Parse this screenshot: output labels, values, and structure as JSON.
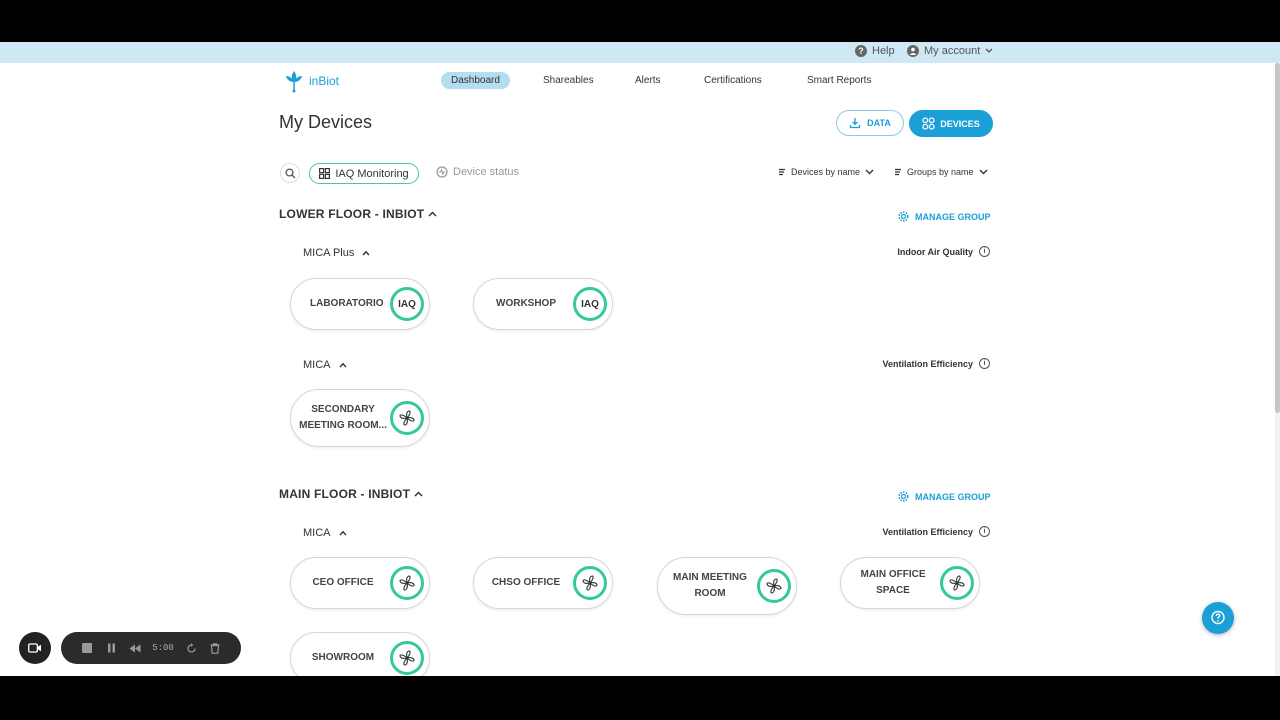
{
  "top_bar": {
    "help_label": "Help",
    "account_label": "My account"
  },
  "logo": {
    "text": "inBiot"
  },
  "nav": {
    "items": [
      {
        "label": "Dashboard",
        "active": true
      },
      {
        "label": "Shareables"
      },
      {
        "label": "Alerts"
      },
      {
        "label": "Certifications"
      },
      {
        "label": "Smart Reports"
      }
    ]
  },
  "page": {
    "title": "My Devices",
    "data_button": "DATA",
    "devices_button": "DEVICES"
  },
  "filters": {
    "monitoring_chip": "IAQ Monitoring",
    "status_chip": "Device status",
    "sort_devices": "Devices by name",
    "sort_groups": "Groups by name"
  },
  "groups": [
    {
      "title": "LOWER FLOOR - INBIOT",
      "manage_label": "MANAGE GROUP",
      "subgroups": [
        {
          "model": "MICA Plus",
          "metric": "Indoor Air Quality",
          "devices": [
            {
              "name": "LABORATORIO",
              "badge": "IAQ"
            },
            {
              "name": "WORKSHOP",
              "badge": "IAQ"
            }
          ]
        },
        {
          "model": "MICA",
          "metric": "Ventilation Efficiency",
          "devices": [
            {
              "name": "SECONDARY MEETING ROOM...",
              "badge_icon": "fan-icon"
            }
          ]
        }
      ]
    },
    {
      "title": "MAIN FLOOR - INBIOT",
      "manage_label": "MANAGE GROUP",
      "subgroups": [
        {
          "model": "MICA",
          "metric": "Ventilation Efficiency",
          "devices": [
            {
              "name": "CEO OFFICE",
              "badge_icon": "fan-icon"
            },
            {
              "name": "CHSO OFFICE",
              "badge_icon": "fan-icon"
            },
            {
              "name": "MAIN MEETING ROOM",
              "badge_icon": "fan-icon"
            },
            {
              "name": "MAIN OFFICE SPACE",
              "badge_icon": "fan-icon"
            },
            {
              "name": "SHOWROOM",
              "badge_icon": "fan-icon"
            }
          ]
        }
      ]
    }
  ],
  "recorder": {
    "time": "5:00"
  },
  "colors": {
    "brand": "#1a9fd6",
    "accent_green": "#34c99a",
    "nav_active_bg": "#b3ddf0",
    "top_bar_bg": "#cfe9f4"
  }
}
